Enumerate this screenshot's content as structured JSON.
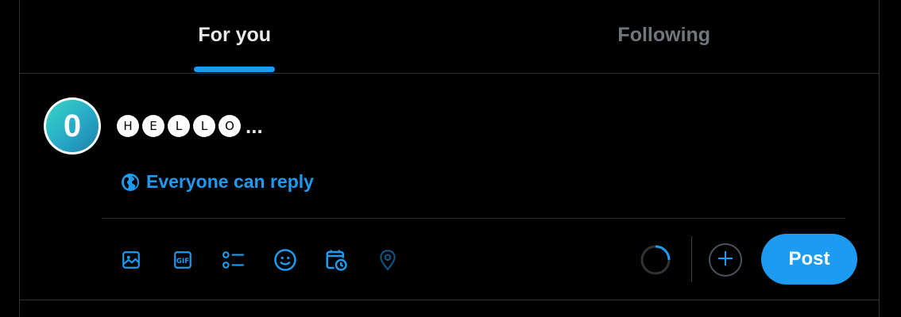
{
  "tabs": [
    {
      "label": "For you",
      "active": true
    },
    {
      "label": "Following",
      "active": false
    }
  ],
  "composer": {
    "avatar_letter": "0",
    "text_letters": [
      "H",
      "E",
      "L",
      "L",
      "O"
    ],
    "text_suffix": "...",
    "reply_setting_label": "Everyone can reply",
    "reply_setting_icon": "globe-icon",
    "toolbar_icons": [
      "image-icon",
      "gif-icon",
      "poll-icon",
      "emoji-icon",
      "schedule-icon",
      "location-icon"
    ],
    "add_icon": "plus-icon",
    "post_label": "Post"
  },
  "colors": {
    "accent": "#1d9bf0",
    "background": "#000000",
    "border": "#2f3336",
    "text_primary": "#e7e9ea",
    "text_secondary": "#71767b"
  }
}
